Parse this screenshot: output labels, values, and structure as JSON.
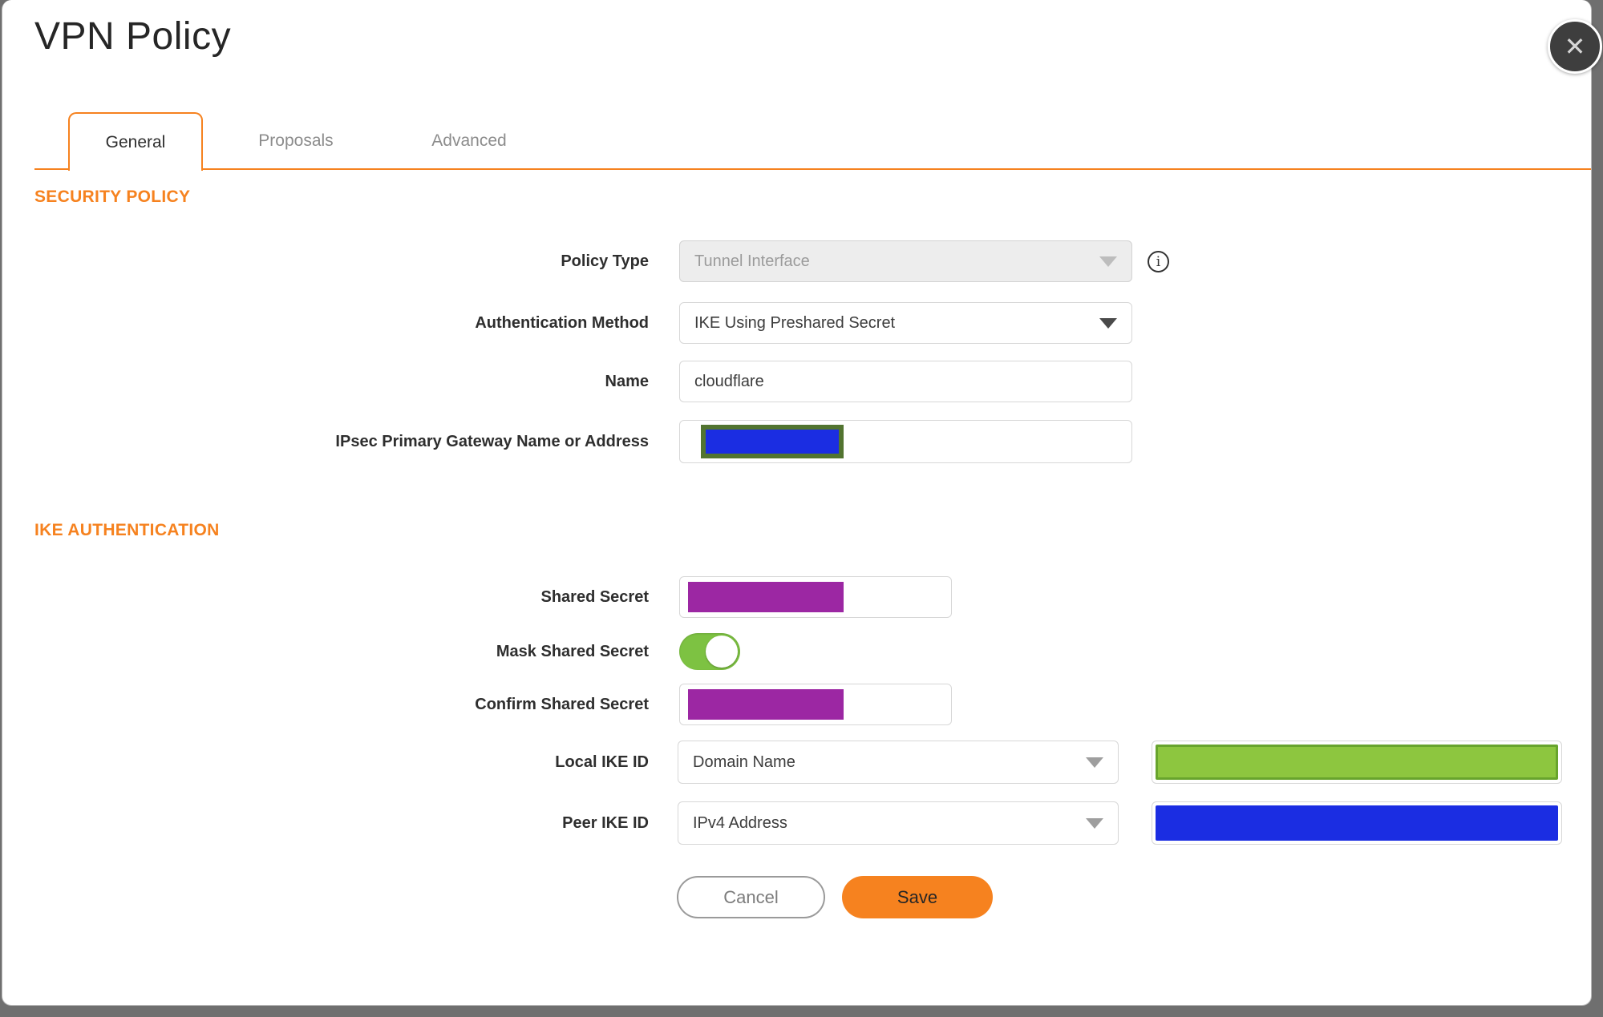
{
  "dialog": {
    "title": "VPN Policy"
  },
  "icons": {
    "close": "✕",
    "info": "i"
  },
  "tabs": [
    {
      "label": "General",
      "active": true
    },
    {
      "label": "Proposals",
      "active": false
    },
    {
      "label": "Advanced",
      "active": false
    }
  ],
  "sections": {
    "security_policy": {
      "heading": "SECURITY POLICY"
    },
    "ike_authentication": {
      "heading": "IKE AUTHENTICATION"
    }
  },
  "fields": {
    "policy_type": {
      "label": "Policy Type",
      "value": "Tunnel Interface",
      "disabled": true
    },
    "authentication_method": {
      "label": "Authentication Method",
      "value": "IKE Using Preshared Secret"
    },
    "name": {
      "label": "Name",
      "value": "cloudflare"
    },
    "ipsec_gateway": {
      "label": "IPsec Primary Gateway Name or Address",
      "value": "",
      "redacted": true
    },
    "shared_secret": {
      "label": "Shared Secret",
      "value": "",
      "redacted": true
    },
    "mask_shared_secret": {
      "label": "Mask Shared Secret",
      "enabled": true
    },
    "confirm_shared_secret": {
      "label": "Confirm Shared Secret",
      "value": "",
      "redacted": true
    },
    "local_ike_id": {
      "label": "Local IKE ID",
      "value": "Domain Name",
      "id_value_redacted": true
    },
    "peer_ike_id": {
      "label": "Peer IKE ID",
      "value": "IPv4 Address",
      "id_value_redacted": true
    }
  },
  "buttons": {
    "cancel": "Cancel",
    "save": "Save"
  },
  "colors": {
    "accent": "#F6821F",
    "redact-purple": "#9C27A3",
    "redact-blue": "#1B2DE2",
    "redact-green": "#8DC63F",
    "redact-green-border": "#68A42D",
    "redact-olive-border": "#527430",
    "toggle-green": "#7DC242",
    "backdrop": "#6F6F6F"
  }
}
